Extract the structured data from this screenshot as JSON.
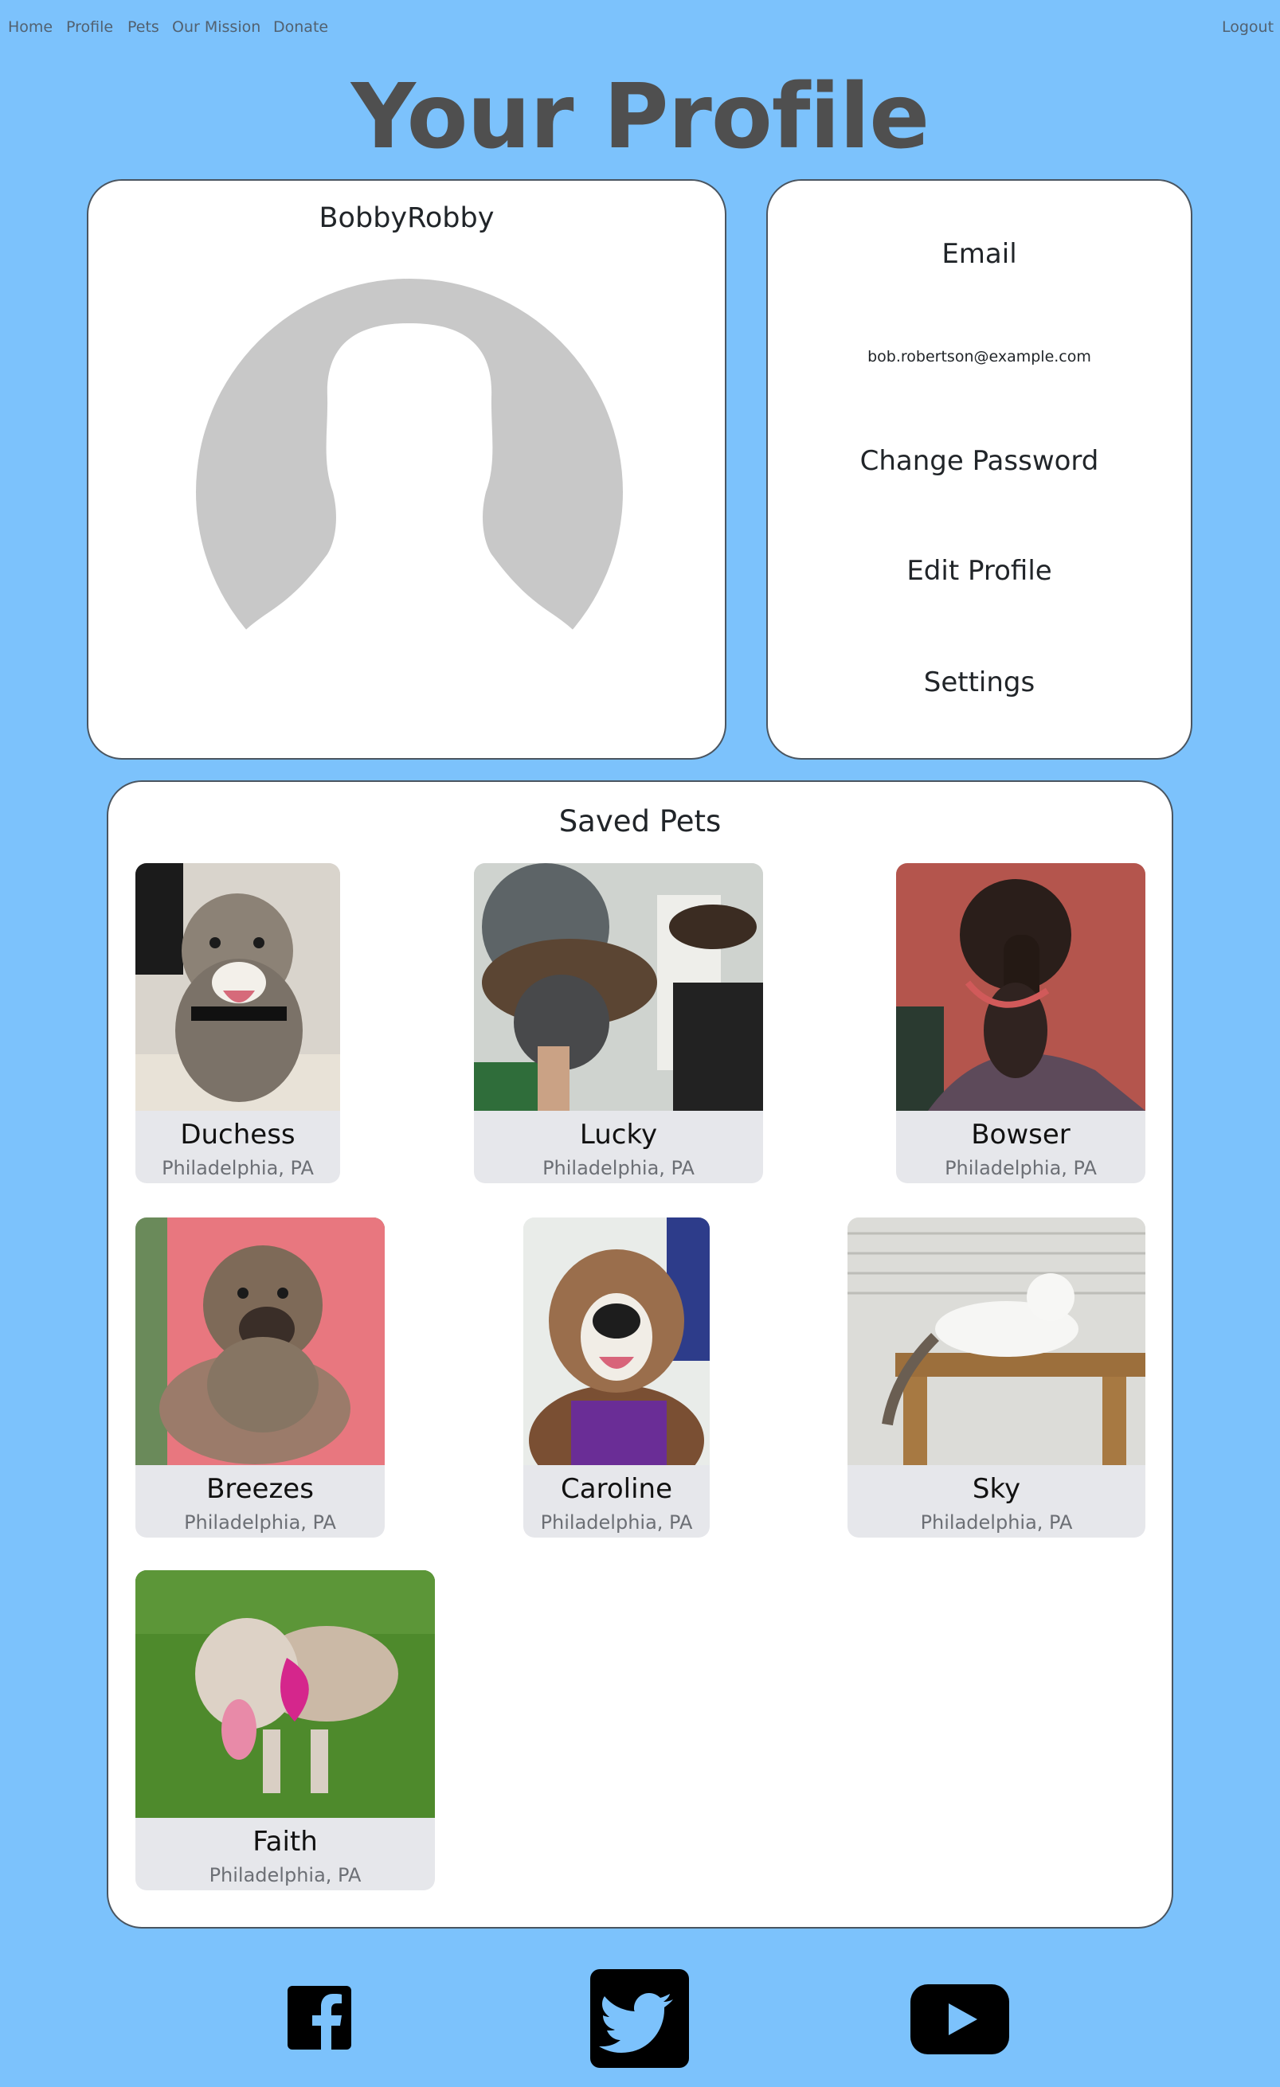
{
  "nav": {
    "home": "Home",
    "profile": "Profile",
    "pets": "Pets",
    "mission": "Our Mission",
    "donate": "Donate",
    "logout": "Logout"
  },
  "page": {
    "title": "Your Profile"
  },
  "profile": {
    "username": "BobbyRobby"
  },
  "account": {
    "email_label": "Email",
    "email_value": "bob.robertson@example.com",
    "change_password": "Change Password",
    "edit_profile": "Edit Profile",
    "settings": "Settings"
  },
  "saved_pets": {
    "title": "Saved Pets",
    "pets": [
      {
        "name": "Duchess",
        "location": "Philadelphia, PA"
      },
      {
        "name": "Lucky",
        "location": "Philadelphia, PA"
      },
      {
        "name": "Bowser",
        "location": "Philadelphia, PA"
      },
      {
        "name": "Breezes",
        "location": "Philadelphia, PA"
      },
      {
        "name": "Caroline",
        "location": "Philadelphia, PA"
      },
      {
        "name": "Sky",
        "location": "Philadelphia, PA"
      },
      {
        "name": "Faith",
        "location": "Philadelphia, PA"
      }
    ]
  },
  "footer": {
    "icons": [
      "facebook-icon",
      "twitter-icon",
      "youtube-icon"
    ]
  },
  "colors": {
    "background": "#7cc2fc",
    "card": "#ffffff",
    "pet_card": "#e6e7eb",
    "title": "#4f4f4f",
    "avatar_silhouette": "#c8c8c8"
  }
}
